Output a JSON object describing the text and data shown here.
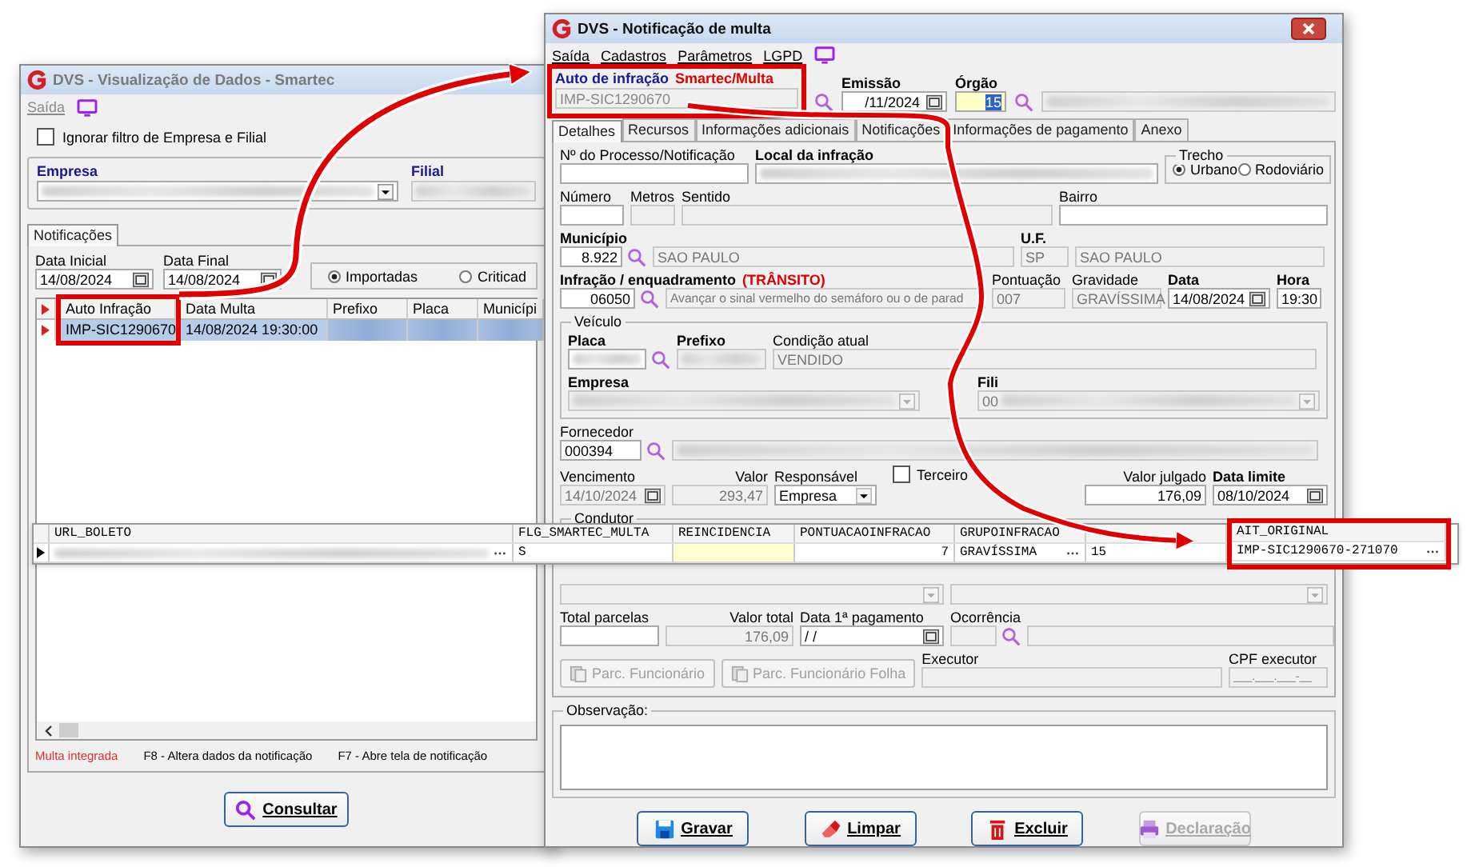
{
  "left_window": {
    "title": "DVS - Visualização de Dados - Smartec",
    "menu": [
      "Saída"
    ],
    "ignore_filter": {
      "label": "Ignorar filtro de Empresa e Filial",
      "checked": false
    },
    "empresa_label": "Empresa",
    "filial_label": "Filial",
    "tabs": [
      {
        "label": "Notificações",
        "selected": true
      }
    ],
    "date_start": {
      "label": "Data Inicial",
      "value": "14/08/2024"
    },
    "date_end": {
      "label": "Data Final",
      "value": "14/08/2024"
    },
    "status_options": [
      {
        "label": "Importadas",
        "selected": true
      },
      {
        "label": "Criticad",
        "selected": false
      }
    ],
    "grid": {
      "columns": [
        "Auto Infração",
        "Data Multa",
        "Prefixo",
        "Placa",
        "Municípi"
      ],
      "rows": [
        {
          "cells": [
            "IMP-SIC1290670",
            "14/08/2024 19:30:00"
          ],
          "selected": true
        }
      ]
    },
    "legend": [
      {
        "text": "Multa integrada",
        "kind": "highlight"
      },
      {
        "text": "F8 - Altera dados da notificação",
        "kind": "hint"
      },
      {
        "text": "F7 - Abre tela de notificação",
        "kind": "hint"
      }
    ],
    "search_button": "Consultar"
  },
  "right_window": {
    "title": "DVS - Notificação de multa",
    "menu": [
      "Saída",
      "Cadastros",
      "Parâmetros",
      "LGPD"
    ],
    "auto": {
      "label": "Auto de infração",
      "tag": "Smartec/Multa",
      "value": "IMP-SIC1290670"
    },
    "emissao": {
      "label": "Emissão",
      "value": "/11/2024"
    },
    "orgao": {
      "label": "Órgão",
      "value": "15"
    },
    "tabs": [
      {
        "label": "Detalhes",
        "selected": true
      },
      {
        "label": "Recursos",
        "selected": false
      },
      {
        "label": "Informações adicionais",
        "selected": false
      },
      {
        "label": "Notificações",
        "selected": false
      },
      {
        "label": "Informações de pagamento",
        "selected": false
      },
      {
        "label": "Anexo",
        "selected": false
      }
    ],
    "form_rows": [
      [
        {
          "label": "Nº do Processo/Notificação",
          "bold": false,
          "kind": "text",
          "disabled": false
        },
        {
          "label": "Local da infração",
          "bold": true,
          "kind": "text",
          "disabled": false,
          "blurred": true
        },
        {
          "label": "Trecho",
          "kind": "radios",
          "options": [
            {
              "label": "Urbano",
              "selected": true
            },
            {
              "label": "Rodoviário",
              "selected": false
            }
          ]
        }
      ],
      [
        {
          "label": "Número",
          "bold": false,
          "kind": "text",
          "disabled": false
        },
        {
          "label": "Metros",
          "bold": false,
          "kind": "text",
          "disabled": true
        },
        {
          "label": "Sentido",
          "bold": false,
          "kind": "text",
          "disabled": true
        },
        {
          "label": "Bairro",
          "bold": false,
          "kind": "text",
          "disabled": false
        }
      ],
      [
        {
          "label": "Município",
          "bold": true,
          "kind": "lookup",
          "value": "8.922",
          "disabled": false
        },
        {
          "kind": "text",
          "value": "SAO PAULO",
          "disabled": true
        },
        {
          "label": "U.F.",
          "bold": true,
          "kind": "text",
          "value": "SP",
          "disabled": true
        },
        {
          "kind": "text",
          "value": "SAO PAULO",
          "disabled": true
        }
      ],
      [
        {
          "label": "Infração / enquadramento",
          "tag": "(TRÂNSITO)",
          "bold": true,
          "kind": "lookup",
          "value": "06050",
          "disabled": false
        },
        {
          "kind": "text",
          "value": "Avançar o sinal vermelho do semáforo ou o de parad",
          "disabled": true
        },
        {
          "label": "Pontuação",
          "bold": false,
          "kind": "text",
          "value": "007",
          "disabled": true
        },
        {
          "label": "Gravidade",
          "bold": false,
          "kind": "text",
          "value": "GRAVÍSSIMA",
          "disabled": true
        },
        {
          "label": "Data",
          "bold": true,
          "kind": "date",
          "value": "14/08/2024",
          "disabled": false
        },
        {
          "label": "Hora",
          "bold": true,
          "kind": "text",
          "value": "19:30",
          "disabled": false
        }
      ]
    ],
    "vehicle": {
      "title": "Veículo",
      "rows": [
        [
          {
            "label": "Placa",
            "bold": true,
            "kind": "lookup",
            "disabled": false,
            "blurred": true
          },
          {
            "label": "Prefixo",
            "bold": true,
            "kind": "text",
            "disabled": true,
            "blurred": true
          },
          {
            "label": "Condição atual",
            "bold": false,
            "kind": "text",
            "value": "VENDIDO",
            "disabled": true
          }
        ],
        [
          {
            "label": "Empresa",
            "bold": true,
            "kind": "combo",
            "disabled": true,
            "blurred": true
          },
          {
            "label": "Fili",
            "bold": true,
            "kind": "combo",
            "value": "00",
            "disabled": true,
            "blurred": true
          }
        ]
      ]
    },
    "form_rows_2": [
      [
        {
          "label": "Fornecedor",
          "bold": false,
          "kind": "lookup",
          "value": "000394",
          "disabled": false
        },
        {
          "kind": "text",
          "disabled": true,
          "blurred": true
        }
      ],
      [
        {
          "label": "Vencimento",
          "bold": false,
          "kind": "date",
          "value": "14/10/2024",
          "disabled": true
        },
        {
          "label": "Valor",
          "bold": false,
          "kind": "amount",
          "value": "293,47",
          "disabled": true
        },
        {
          "label": "Responsável",
          "bold": false,
          "kind": "combo",
          "value": "Empresa",
          "disabled": false
        },
        {
          "label": "Terceiro",
          "kind": "check",
          "checked": false
        },
        {
          "label": "Valor julgado",
          "bold": false,
          "kind": "amount",
          "value": "176,09",
          "disabled": false
        },
        {
          "label": "Data limite",
          "bold": true,
          "kind": "date",
          "value": "08/10/2024",
          "disabled": false
        }
      ]
    ],
    "condutor": {
      "title": "Condutor"
    },
    "form_rows_3": [
      [
        {
          "kind": "combo",
          "disabled": true
        },
        {
          "kind": "combo",
          "disabled": true
        }
      ],
      [
        {
          "label": "Total parcelas",
          "bold": false,
          "kind": "text",
          "disabled": false
        },
        {
          "label": "Valor total",
          "bold": false,
          "kind": "amount",
          "value": "176,09",
          "disabled": true
        },
        {
          "label": "Data 1ª pagamento",
          "bold": false,
          "kind": "date",
          "value": " / /",
          "disabled": false
        },
        {
          "label": "Ocorrência",
          "bold": false,
          "kind": "lookup",
          "disabled": true
        },
        {
          "kind": "text",
          "disabled": true
        }
      ]
    ],
    "parc_buttons": [
      {
        "label": "Parc. Funcionário",
        "disabled": true
      },
      {
        "label": "Parc. Funcionário Folha",
        "disabled": true
      }
    ],
    "executor": {
      "label": "Executor"
    },
    "cpf_executor": {
      "label": "CPF executor",
      "value": "___.___.___-__"
    },
    "observacao": {
      "title": "Observação:"
    },
    "buttons": [
      {
        "label": "Gravar",
        "kind": "save",
        "disabled": false
      },
      {
        "label": "Limpar",
        "kind": "clear",
        "disabled": false
      },
      {
        "label": "Excluir",
        "kind": "delete",
        "disabled": false
      },
      {
        "label": "Declaração",
        "kind": "print",
        "disabled": true
      }
    ]
  },
  "detail_grid": {
    "columns": [
      {
        "label": "URL_BOLETO"
      },
      {
        "label": "FLG_SMARTEC_MULTA"
      },
      {
        "label": "REINCIDENCIA"
      },
      {
        "label": "PONTUACAOINFRACAO"
      },
      {
        "label": "GRUPOINFRACAO"
      },
      {},
      {
        "label": "AIT_ORIGINAL"
      }
    ],
    "rows": [
      {
        "cells": [
          {
            "blurred": true,
            "button": true,
            "highlighted": false
          },
          {
            "value": "S",
            "blurred": false,
            "button": false,
            "highlighted": false
          },
          {
            "blurred": false,
            "button": false,
            "highlighted": true
          },
          {
            "value": "7",
            "blurred": false,
            "button": false,
            "highlighted": false
          },
          {
            "value": "GRAVÍSSIMA",
            "blurred": false,
            "button": true,
            "highlighted": false
          },
          {
            "value": "15",
            "blurred": false,
            "button": false,
            "highlighted": false
          },
          {
            "value": "IMP-SIC1290670-271070",
            "blurred": false,
            "button": true,
            "highlighted": false
          }
        ]
      }
    ]
  }
}
